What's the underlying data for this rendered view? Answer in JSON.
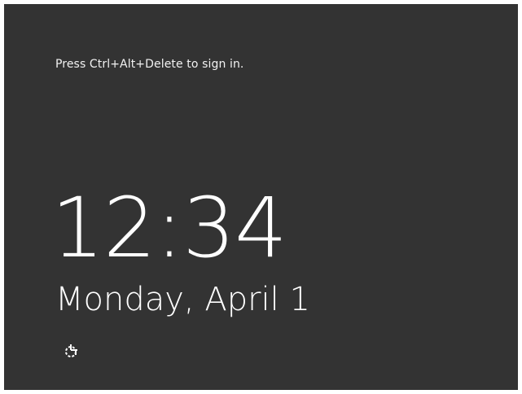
{
  "lock_screen": {
    "prompt_text": "Press Ctrl+Alt+Delete to sign in.",
    "time": "12:34",
    "date": "Monday, April 1",
    "ease_of_access_icon": "ease-of-access-icon",
    "background_color": "#333333",
    "text_color": "#ffffff"
  }
}
